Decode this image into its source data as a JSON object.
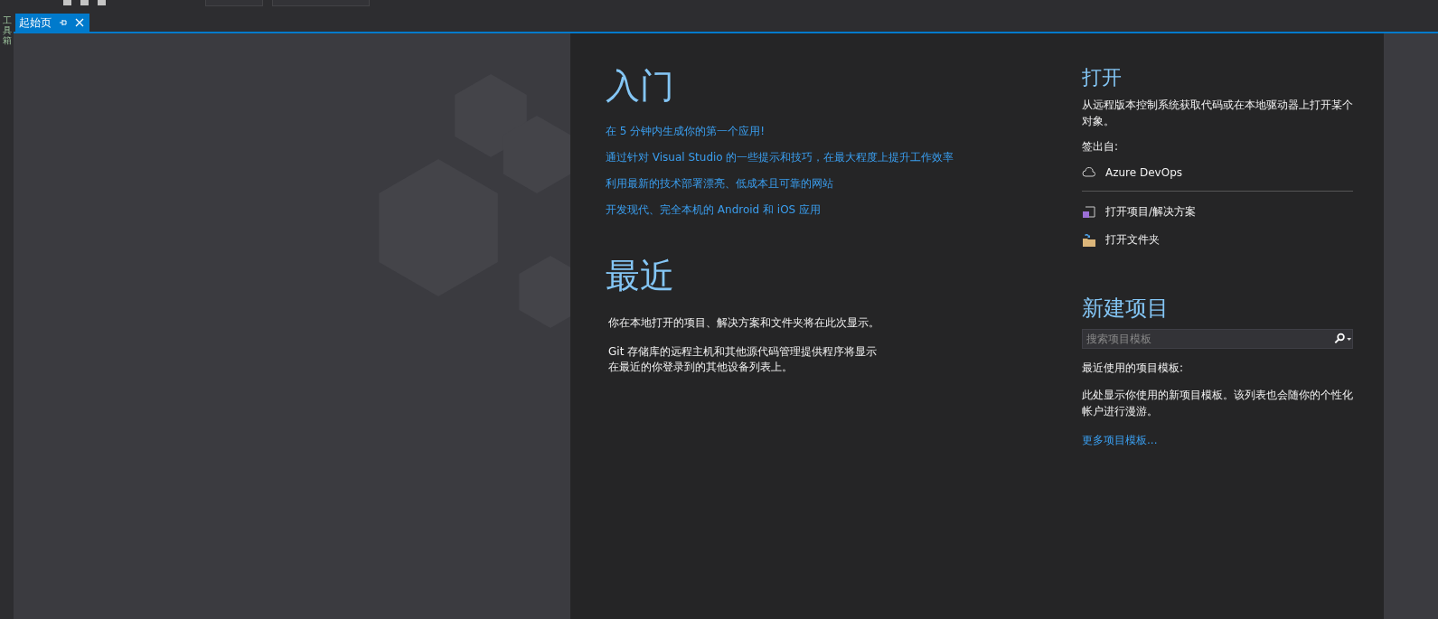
{
  "toolbox": {
    "label": "工具箱"
  },
  "tabs": [
    {
      "label": "起始页",
      "selected": true
    }
  ],
  "get_started": {
    "title": "入门",
    "links": [
      "在 5 分钟内生成你的第一个应用!",
      "通过针对 Visual Studio 的一些提示和技巧，在最大程度上提升工作效率",
      "利用最新的技术部署漂亮、低成本且可靠的网站",
      "开发现代、完全本机的 Android 和 iOS 应用"
    ]
  },
  "recent": {
    "title": "最近",
    "paragraphs": [
      [
        "你在本地打开的项目、解决方案和文件夹将在此次显示。"
      ],
      [
        "Git 存储库的远程主机和其他源代码管理提供程序将显示",
        "在最近的你登录到的其他设备列表上。"
      ]
    ]
  },
  "open": {
    "title": "打开",
    "description": "从远程版本控制系统获取代码或在本地驱动器上打开某个对象。",
    "checkout_label": "签出自:",
    "sources": [
      {
        "label": "Azure DevOps",
        "kind": "cloud"
      }
    ],
    "actions": [
      {
        "label": "打开项目/解决方案",
        "kind": "solution"
      },
      {
        "label": "打开文件夹",
        "kind": "folder"
      }
    ]
  },
  "new_project": {
    "title": "新建项目",
    "search": {
      "placeholder": "搜索项目模板"
    },
    "recent_label": "最近使用的项目模板:",
    "description": "此处显示你使用的新项目模板。该列表也会随你的个性化帐户进行漫游。",
    "more_link": "更多项目模板..."
  }
}
